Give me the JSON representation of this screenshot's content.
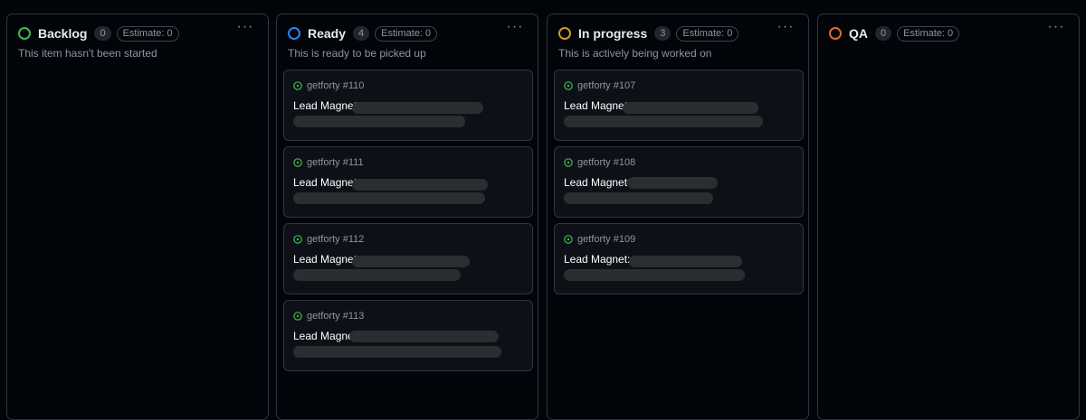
{
  "columns": [
    {
      "title": "Backlog",
      "count": "0",
      "estimate": "Estimate: 0",
      "description": "This item hasn't been started",
      "status_color": "#3fb950",
      "cards": []
    },
    {
      "title": "Ready",
      "count": "4",
      "estimate": "Estimate: 0",
      "description": "This is ready to be picked up",
      "status_color": "#2f81f7",
      "cards": [
        {
          "ref": "getforty #110",
          "title": "Lead Magnet:"
        },
        {
          "ref": "getforty #111",
          "title": "Lead Magnet:"
        },
        {
          "ref": "getforty #112",
          "title": "Lead Magnet:"
        },
        {
          "ref": "getforty #113",
          "title": "Lead Magnet."
        }
      ]
    },
    {
      "title": "In progress",
      "count": "3",
      "estimate": "Estimate: 0",
      "description": "This is actively being worked on",
      "status_color": "#d29922",
      "cards": [
        {
          "ref": "getforty #107",
          "title": "Lead Magnet:"
        },
        {
          "ref": "getforty #108",
          "title": "Lead Magnet:"
        },
        {
          "ref": "getforty #109",
          "title": "Lead Magnet:"
        }
      ]
    },
    {
      "title": "QA",
      "count": "0",
      "estimate": "Estimate: 0",
      "description": "",
      "status_color": "#db6d28",
      "cards": []
    }
  ],
  "icons": {
    "column_status": "circle-outline-icon",
    "issue_open": "issue-opened-icon",
    "more": "kebab-horizontal-icon"
  },
  "colors": {
    "issue_open": "#3fb950"
  }
}
